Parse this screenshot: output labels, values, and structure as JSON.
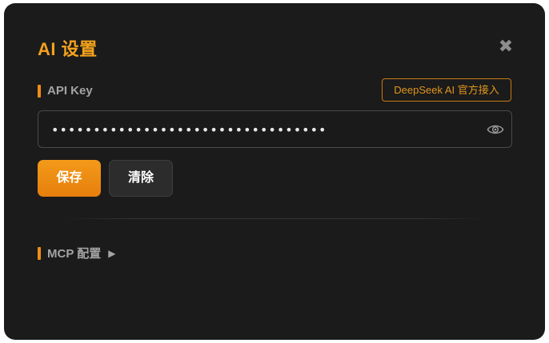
{
  "dialog": {
    "title": "AI 设置",
    "close_icon": "close-icon"
  },
  "api_key": {
    "label": "API Key",
    "provider_link": "DeepSeek AI 官方接入",
    "value": "sk-3f9a8c2d7e1b4a6f9d2c8e7b1a3f5c",
    "input_type": "password",
    "visibility_icon": "eye-icon"
  },
  "actions": {
    "save_label": "保存",
    "clear_label": "清除"
  },
  "mcp": {
    "label": "MCP 配置",
    "expand_icon": "caret-right-icon",
    "expanded": false
  },
  "colors": {
    "accent": "#f4a21c",
    "background": "#1b1b1b",
    "save_button": "#ee8c14",
    "muted_text": "#a4a4a4"
  }
}
